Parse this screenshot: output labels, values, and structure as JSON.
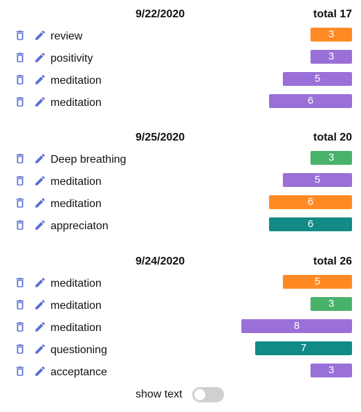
{
  "colors": {
    "orange": "#ff8a24",
    "purple": "#9a6fd8",
    "green": "#48b26b",
    "teal": "#128a86",
    "icon": "#5b6fd6"
  },
  "groups": [
    {
      "date": "9/22/2020",
      "total": "total 17",
      "items": [
        {
          "label": "review",
          "value": "3",
          "color": "orange"
        },
        {
          "label": "positivity",
          "value": "3",
          "color": "purple"
        },
        {
          "label": "meditation",
          "value": "5",
          "color": "purple"
        },
        {
          "label": "meditation",
          "value": "6",
          "color": "purple"
        }
      ]
    },
    {
      "date": "9/25/2020",
      "total": "total 20",
      "items": [
        {
          "label": "Deep breathing",
          "value": "3",
          "color": "green"
        },
        {
          "label": "meditation",
          "value": "5",
          "color": "purple"
        },
        {
          "label": "meditation",
          "value": "6",
          "color": "orange"
        },
        {
          "label": "appreciaton",
          "value": "6",
          "color": "teal"
        }
      ]
    },
    {
      "date": "9/24/2020",
      "total": "total 26",
      "items": [
        {
          "label": "meditation",
          "value": "5",
          "color": "orange"
        },
        {
          "label": "meditation",
          "value": "3",
          "color": "green"
        },
        {
          "label": "meditation",
          "value": "8",
          "color": "purple"
        },
        {
          "label": "questioning",
          "value": "7",
          "color": "teal"
        },
        {
          "label": "acceptance",
          "value": "3",
          "color": "purple"
        }
      ]
    }
  ],
  "toggle": {
    "label": "show text",
    "checked": false
  }
}
